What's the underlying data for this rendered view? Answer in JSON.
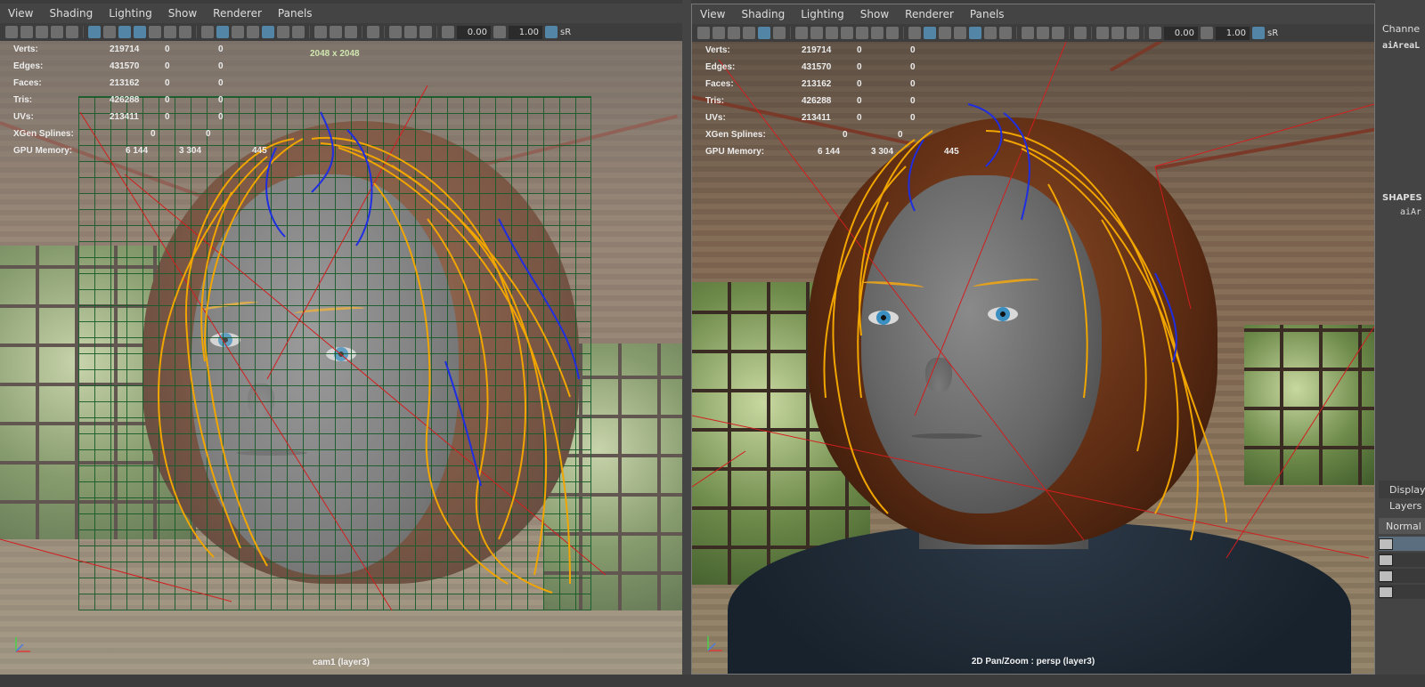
{
  "menu": [
    "View",
    "Shading",
    "Lighting",
    "Show",
    "Renderer",
    "Panels"
  ],
  "toolbar": {
    "exposure": "0.00",
    "gamma": "1.00",
    "colorspace": "sR"
  },
  "hud": {
    "rows": [
      {
        "label": "Verts:",
        "a": "219714",
        "b": "0",
        "c": "0"
      },
      {
        "label": "Edges:",
        "a": "431570",
        "b": "0",
        "c": "0"
      },
      {
        "label": "Faces:",
        "a": "213162",
        "b": "0",
        "c": "0"
      },
      {
        "label": "Tris:",
        "a": "426288",
        "b": "0",
        "c": "0"
      },
      {
        "label": "UVs:",
        "a": "213411",
        "b": "0",
        "c": "0"
      }
    ],
    "xgen": {
      "label": "XGen Splines:",
      "a": "0",
      "b": "0"
    },
    "gpu": {
      "label": "GPU Memory:",
      "a": "6 144",
      "b": "3 304",
      "c": "445"
    }
  },
  "left_view": {
    "resolution": "2048 x 2048",
    "camera": "cam1 (layer3)"
  },
  "right_view": {
    "camera": "2D Pan/Zoom : persp (layer3)"
  },
  "side_panel": {
    "title": "Channe",
    "object": "aiAreaL",
    "shapes_label": "SHAPES",
    "shape_item": "aiAr",
    "display_tab": "Display",
    "layers_tab": "Layers",
    "blend_mode": "Normal"
  },
  "colors": {
    "accent": "#5285a6",
    "hair_guides": "#f0a500",
    "guide_blue": "#1e2ee0",
    "light_lines": "#d21e1e",
    "resolution_gate": "#1e5f33"
  }
}
